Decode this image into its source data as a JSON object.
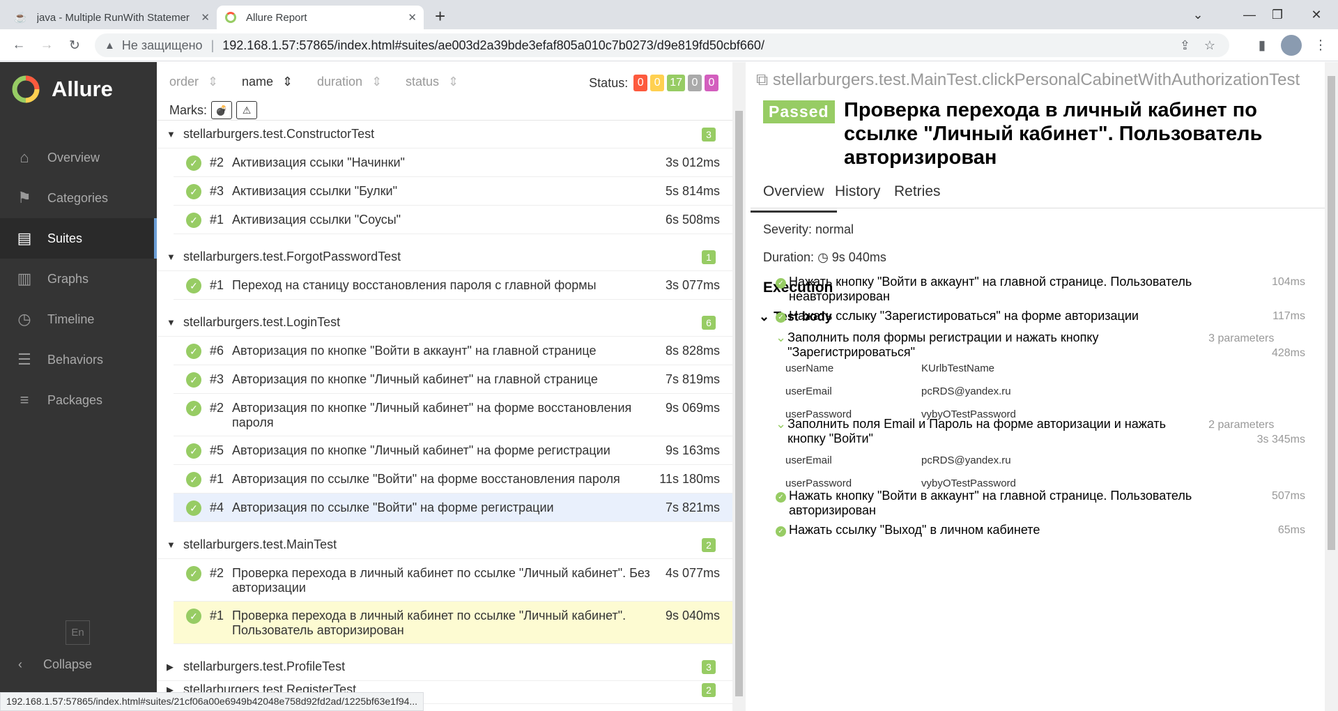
{
  "browser": {
    "tabs": [
      {
        "title": "java - Multiple RunWith Statemer"
      },
      {
        "title": "Allure Report"
      }
    ],
    "not_secure": "Не защищено",
    "url": "192.168.1.57:57865/index.html#suites/ae003d2a39bde3efaf805a010c7b0273/d9e819fd50cbf660/",
    "status_url": "192.168.1.57:57865/index.html#suites/21cf06a00e6949b42048e758d92fd2ad/1225bf63e1f94..."
  },
  "sidebar": {
    "brand": "Allure",
    "items": [
      {
        "label": "Overview",
        "icon": "home-icon"
      },
      {
        "label": "Categories",
        "icon": "flag-icon"
      },
      {
        "label": "Suites",
        "icon": "briefcase-icon"
      },
      {
        "label": "Graphs",
        "icon": "bar-chart-icon"
      },
      {
        "label": "Timeline",
        "icon": "clock-icon"
      },
      {
        "label": "Behaviors",
        "icon": "list-icon"
      },
      {
        "label": "Packages",
        "icon": "align-left-icon"
      }
    ],
    "lang": "En",
    "collapse": "Collapse"
  },
  "toolbar": {
    "sorts": [
      "order",
      "name",
      "duration",
      "status"
    ],
    "status_label": "Status:",
    "status_counts": [
      "0",
      "0",
      "17",
      "0",
      "0"
    ],
    "marks_label": "Marks:"
  },
  "groups": [
    {
      "name": "stellarburgers.test.ConstructorTest",
      "count": "3",
      "rows": [
        {
          "num": "#2",
          "name": "Активизация ссыки \"Начинки\"",
          "dur": "3s 012ms"
        },
        {
          "num": "#3",
          "name": "Активизация ссылки \"Булки\"",
          "dur": "5s 814ms"
        },
        {
          "num": "#1",
          "name": "Активизация ссылки \"Соусы\"",
          "dur": "6s 508ms"
        }
      ]
    },
    {
      "name": "stellarburgers.test.ForgotPasswordTest",
      "count": "1",
      "rows": [
        {
          "num": "#1",
          "name": "Переход на станицу восстановления пароля с главной формы",
          "dur": "3s 077ms"
        }
      ]
    },
    {
      "name": "stellarburgers.test.LoginTest",
      "count": "6",
      "rows": [
        {
          "num": "#6",
          "name": "Авторизация по кнопке \"Войти в аккаунт\" на главной странице",
          "dur": "8s 828ms"
        },
        {
          "num": "#3",
          "name": "Авторизация по кнопке \"Личный кабинет\" на главной странице",
          "dur": "7s 819ms"
        },
        {
          "num": "#2",
          "name": "Авторизация по кнопке \"Личный кабинет\" на форме восстановления пароля",
          "dur": "9s 069ms"
        },
        {
          "num": "#5",
          "name": "Авторизация по кнопке \"Личный кабинет\" на форме регистрации",
          "dur": "9s 163ms"
        },
        {
          "num": "#1",
          "name": "Авторизация по ссылке \"Войти\" на форме восстановления пароля",
          "dur": "11s 180ms"
        },
        {
          "num": "#4",
          "name": "Авторизация по ссылке \"Войти\" на форме регистрации",
          "dur": "7s 821ms"
        }
      ]
    },
    {
      "name": "stellarburgers.test.MainTest",
      "count": "2",
      "rows": [
        {
          "num": "#2",
          "name": "Проверка перехода в личный кабинет по ссылке \"Личный кабинет\". Без авторизации",
          "dur": "4s 077ms"
        },
        {
          "num": "#1",
          "name": "Проверка перехода в личный кабинет по ссылке \"Личный кабинет\". Пользователь авторизирован",
          "dur": "9s 040ms"
        }
      ]
    },
    {
      "name": "stellarburgers.test.ProfileTest",
      "count": "3",
      "rows": []
    },
    {
      "name": "stellarburgers.test.RegisterTest",
      "count": "2",
      "rows": []
    }
  ],
  "detail": {
    "fullname": "stellarburgers.test.MainTest.clickPersonalCabinetWithAuthorizationTest",
    "status": "Passed",
    "title": "Проверка перехода в личный кабинет по ссылке \"Личный кабинет\". Пользователь авторизирован",
    "tabs": [
      "Overview",
      "History",
      "Retries"
    ],
    "severity": "Severity: normal",
    "duration_label": "Duration:",
    "duration": "9s 040ms",
    "execution": "Execution",
    "test_body": "Test body",
    "steps": [
      {
        "text": "Нажать кнопку \"Войти в аккаунт\" на главной странице. Пользователь неавторизирован",
        "time": "104ms"
      },
      {
        "text": "Нажать сслыку \"Зарегистироваться\" на форме авторизации",
        "time": "117ms"
      },
      {
        "text": "Заполнить поля формы регистрации и нажать кнопку \"Зарегистрироваться\"",
        "params": "3 parameters",
        "time": "428ms",
        "kv": [
          [
            "userName",
            "KUrlbTestName"
          ],
          [
            "userEmail",
            "pcRDS@yandex.ru"
          ],
          [
            "userPassword",
            "vybyOTestPassword"
          ]
        ]
      },
      {
        "text": "Заполнить поля Email и Пароль на форме авторизации и нажать кнопку \"Войти\"",
        "params": "2 parameters",
        "time": "3s 345ms",
        "kv": [
          [
            "userEmail",
            "pcRDS@yandex.ru"
          ],
          [
            "userPassword",
            "vybyOTestPassword"
          ]
        ]
      },
      {
        "text": "Нажать кнопку \"Войти в аккаунт\" на главной странице. Пользователь авторизирован",
        "time": "507ms"
      },
      {
        "text": "Нажать ссылку \"Выход\" в личном кабинете",
        "time": "65ms"
      }
    ]
  },
  "colors": {
    "passed": "#97cc64",
    "failed": "#fd5a3e",
    "broken": "#ffd050",
    "skipped": "#aaaaaa",
    "unknown": "#d35ebe"
  }
}
